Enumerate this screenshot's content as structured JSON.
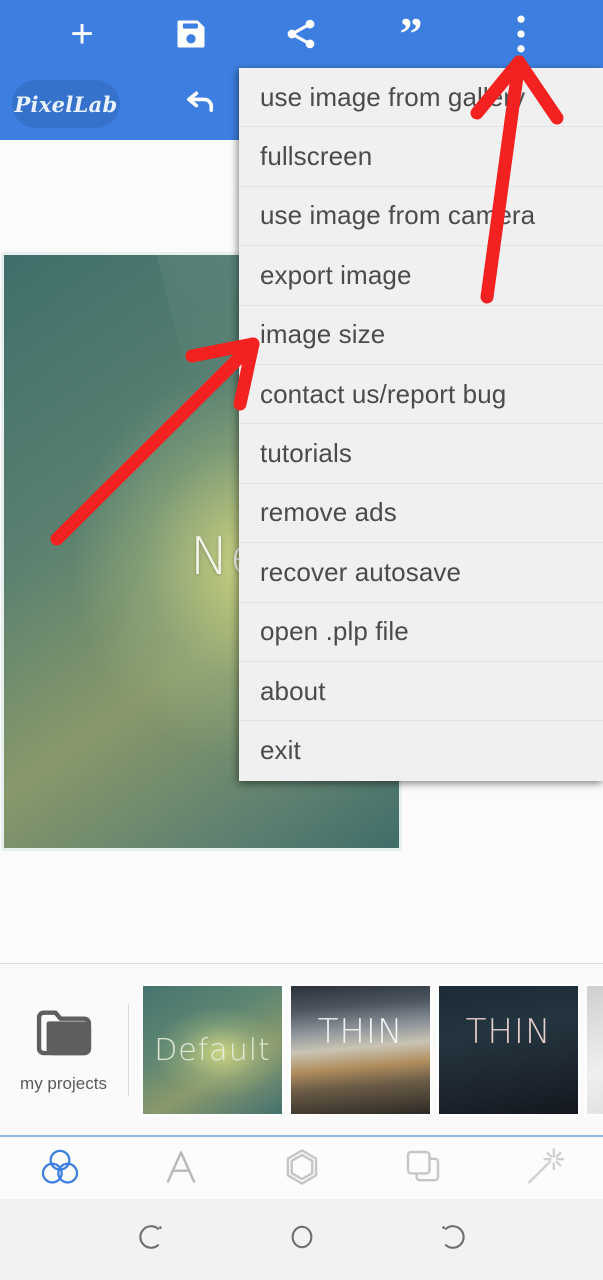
{
  "app": {
    "name": "PixelLab",
    "accent_blue": "#3d7fe0",
    "logo_pill_blue": "#3572cc",
    "menu_bg": "#f0f0f0",
    "menu_text_color": "#4b4b4b",
    "annotation_color": "#f42121"
  },
  "topbar": {
    "actions": [
      {
        "name": "add",
        "icon": "plus-icon",
        "glyph": "+"
      },
      {
        "name": "save",
        "icon": "save-floppy-icon"
      },
      {
        "name": "share",
        "icon": "share-icon"
      },
      {
        "name": "quote",
        "icon": "quote-icon",
        "glyph": "”"
      },
      {
        "name": "overflow",
        "icon": "three-dots-vertical-icon"
      }
    ],
    "logo_label": "PixelLab",
    "undo_label": "undo"
  },
  "canvas": {
    "text": "Ne",
    "project_name": "Default"
  },
  "overflow_menu": {
    "items": [
      "use image from gallery",
      "fullscreen",
      "use image from camera",
      "export image",
      "image size",
      "contact us/report bug",
      "tutorials",
      "remove ads",
      "recover autosave",
      "open .plp file",
      "about",
      "exit"
    ]
  },
  "projects_bar": {
    "my_projects_label": "my projects",
    "my_projects_icon": "folder-icon",
    "thumbnails": [
      {
        "label": "Default",
        "name": "thumbnail-default"
      },
      {
        "label": "THIN",
        "name": "thumbnail-thin-bokeh"
      },
      {
        "label": "THIN",
        "name": "thumbnail-thin-dark"
      },
      {
        "label": "",
        "name": "thumbnail-partial"
      }
    ]
  },
  "tool_tabs": {
    "items": [
      {
        "name": "tab-effects",
        "icon": "three-circles-icon",
        "active": true
      },
      {
        "name": "tab-text",
        "icon": "letter-a-icon",
        "active": false
      },
      {
        "name": "tab-shape",
        "icon": "hexagon-icon",
        "active": false
      },
      {
        "name": "tab-layers",
        "icon": "layers-icon",
        "active": false
      },
      {
        "name": "tab-magic",
        "icon": "magic-wand-icon",
        "active": false
      }
    ],
    "active_color": "#3d7fe0",
    "inactive_color": "#b9b9b9"
  },
  "navbar": {
    "buttons": [
      {
        "name": "nav-back",
        "icon": "back-arrow-icon"
      },
      {
        "name": "nav-home",
        "icon": "home-circle-icon"
      },
      {
        "name": "nav-recents",
        "icon": "recents-icon"
      }
    ]
  },
  "annotations": {
    "arrow_1_target": "three-dots-vertical-icon",
    "arrow_2_target": "image size"
  }
}
